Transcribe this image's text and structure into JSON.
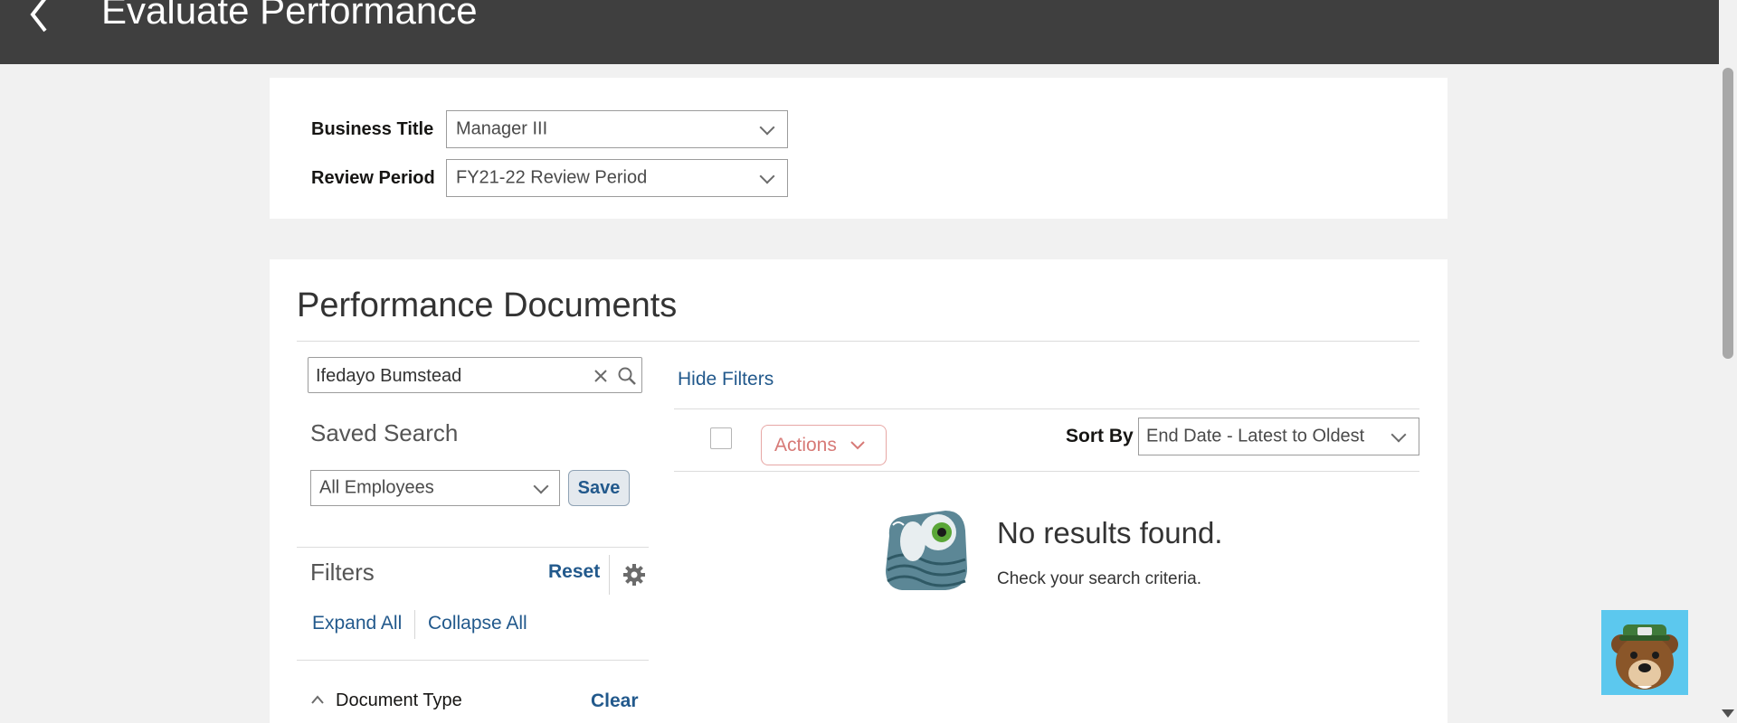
{
  "header": {
    "title": "Evaluate Performance",
    "back_icon": "chevron-left-icon"
  },
  "context": {
    "business_title_label": "Business Title",
    "business_title_value": "Manager III",
    "review_period_label": "Review Period",
    "review_period_value": "FY21-22 Review Period"
  },
  "documents": {
    "section_title": "Performance Documents",
    "search_value": "Ifedayo Bumstead",
    "hide_filters": "Hide Filters",
    "saved_search_title": "Saved Search",
    "saved_search_value": "All Employees",
    "save_label": "Save",
    "filters_title": "Filters",
    "reset_label": "Reset",
    "expand_all": "Expand All",
    "collapse_all": "Collapse All",
    "document_type_label": "Document Type",
    "clear_label": "Clear",
    "actions_label": "Actions",
    "sort_by_label": "Sort By",
    "sort_by_value": "End Date - Latest to Oldest",
    "empty_title": "No results found.",
    "empty_subtitle": "Check your search criteria."
  },
  "colors": {
    "header_bg": "#3f3f3f",
    "link": "#22598c",
    "actions_disabled": "#d77a77"
  }
}
